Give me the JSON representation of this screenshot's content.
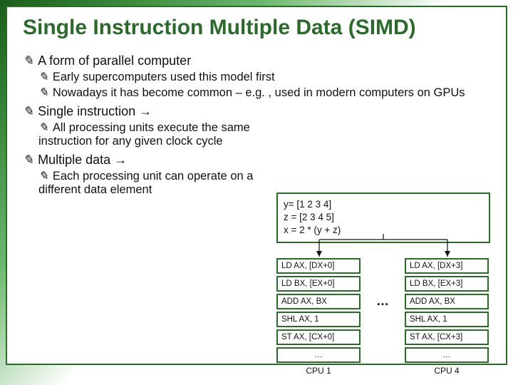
{
  "title": "Single Instruction Multiple Data (SIMD)",
  "bullets": {
    "b1": "A form of parallel computer",
    "b1a": "Early supercomputers used this model first",
    "b1b": "Nowadays it has become common – e.g. , used in modern computers on GPUs",
    "b2_pre": "Single instruction ",
    "b2_arrow": "→",
    "b2a": "All processing units execute the same instruction for any given clock cycle",
    "b3_pre": "Multiple data ",
    "b3_arrow": "→",
    "b3a": "Each processing unit can operate on a different data element"
  },
  "init": {
    "l1": "y= [1 2 3 4]",
    "l2": "z = [2 3 4 5]",
    "l3": "x = 2 * (y + z)"
  },
  "cpu1": {
    "i1": "LD AX, [DX+0]",
    "i2": "LD BX, [EX+0]",
    "i3": "ADD AX, BX",
    "i4": "SHL AX, 1",
    "i5": "ST AX, [CX+0]",
    "i6": "…",
    "label": "CPU 1"
  },
  "cpu4": {
    "i1": "LD AX, [DX+3]",
    "i2": "LD BX, [EX+3]",
    "i3": "ADD AX, BX",
    "i4": "SHL AX, 1",
    "i5": "ST AX, [CX+3]",
    "i6": "…",
    "label": "CPU 4"
  },
  "ellipsis": "…"
}
